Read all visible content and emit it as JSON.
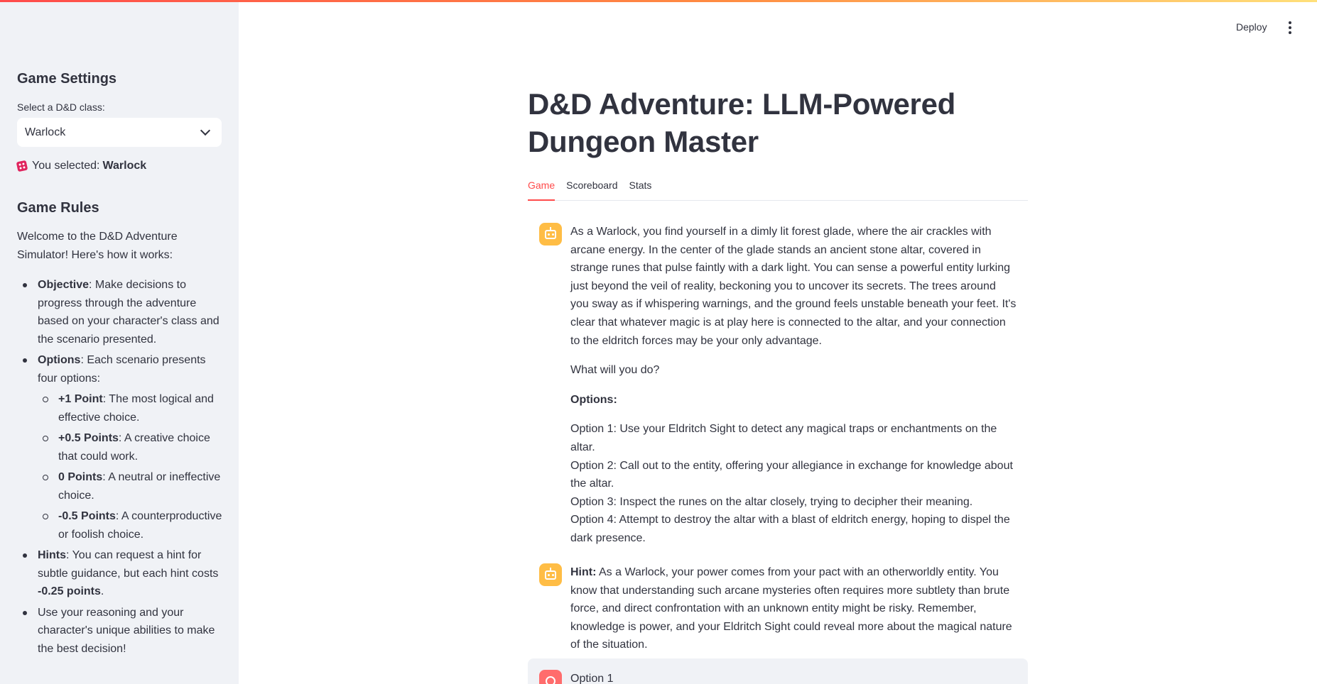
{
  "colors": {
    "sidebar_bg": "#f0f2f6",
    "accent": "#ff4b4b",
    "assistant_avatar": "#ffbd45",
    "user_avatar": "#ff6c6c",
    "text": "#31333f"
  },
  "header": {
    "deploy_label": "Deploy",
    "menu_icon": "kebab-menu-icon"
  },
  "sidebar": {
    "settings_title": "Game Settings",
    "class_select": {
      "label": "Select a D&D class:",
      "value": "Warlock"
    },
    "selected_prefix": "You selected:",
    "selected_value": "Warlock",
    "selected_icon": "dice-icon",
    "rules_title": "Game Rules",
    "rules_intro": "Welcome to the D&D Adventure Simulator! Here's how it works:",
    "rules": [
      {
        "term": "Objective",
        "text": ": Make decisions to progress through the adventure based on your character's class and the scenario presented."
      },
      {
        "term": "Options",
        "text": ": Each scenario presents four options:"
      },
      {
        "term": "Hints",
        "text": ": You can request a hint for subtle guidance, but each hint costs ",
        "strong_tail": "-0.25 points",
        "tail": "."
      },
      {
        "term": "",
        "text": "Use your reasoning and your character's unique abilities to make the best decision!"
      }
    ],
    "option_points": [
      {
        "term": "+1 Point",
        "text": ": The most logical and effective choice."
      },
      {
        "term": "+0.5 Points",
        "text": ": A creative choice that could work."
      },
      {
        "term": "0 Points",
        "text": ": A neutral or ineffective choice."
      },
      {
        "term": "-0.5 Points",
        "text": ": A counterproductive or foolish choice."
      }
    ]
  },
  "main": {
    "title": "D&D Adventure: LLM-Powered Dungeon Master",
    "tabs": [
      {
        "label": "Game",
        "active": true
      },
      {
        "label": "Scoreboard",
        "active": false
      },
      {
        "label": "Stats",
        "active": false
      }
    ],
    "messages": [
      {
        "role": "assistant",
        "avatar_icon": "robot-icon",
        "scenario": "As a Warlock, you find yourself in a dimly lit forest glade, where the air crackles with arcane energy. In the center of the glade stands an ancient stone altar, covered in strange runes that pulse faintly with a dark light. You can sense a powerful entity lurking just beyond the veil of reality, beckoning you to uncover its secrets. The trees around you sway as if whispering warnings, and the ground feels unstable beneath your feet. It's clear that whatever magic is at play here is connected to the altar, and your connection to the eldritch forces may be your only advantage.",
        "prompt": "What will you do?",
        "options_heading": "Options:",
        "options": [
          "Option 1: Use your Eldritch Sight to detect any magical traps or enchantments on the altar.",
          "Option 2: Call out to the entity, offering your allegiance in exchange for knowledge about the altar.",
          "Option 3: Inspect the runes on the altar closely, trying to decipher their meaning.",
          "Option 4: Attempt to destroy the altar with a blast of eldritch energy, hoping to dispel the dark presence."
        ]
      },
      {
        "role": "assistant",
        "avatar_icon": "robot-icon",
        "hint_label": "Hint:",
        "hint_text": " As a Warlock, your power comes from your pact with an otherworldly entity. You know that understanding such arcane mysteries often requires more subtlety than brute force, and direct confrontation with an unknown entity might be risky. Remember, knowledge is power, and your Eldritch Sight could reveal more about the magical nature of the situation."
      },
      {
        "role": "user",
        "avatar_icon": "user-icon",
        "text": "Option 1"
      }
    ]
  }
}
